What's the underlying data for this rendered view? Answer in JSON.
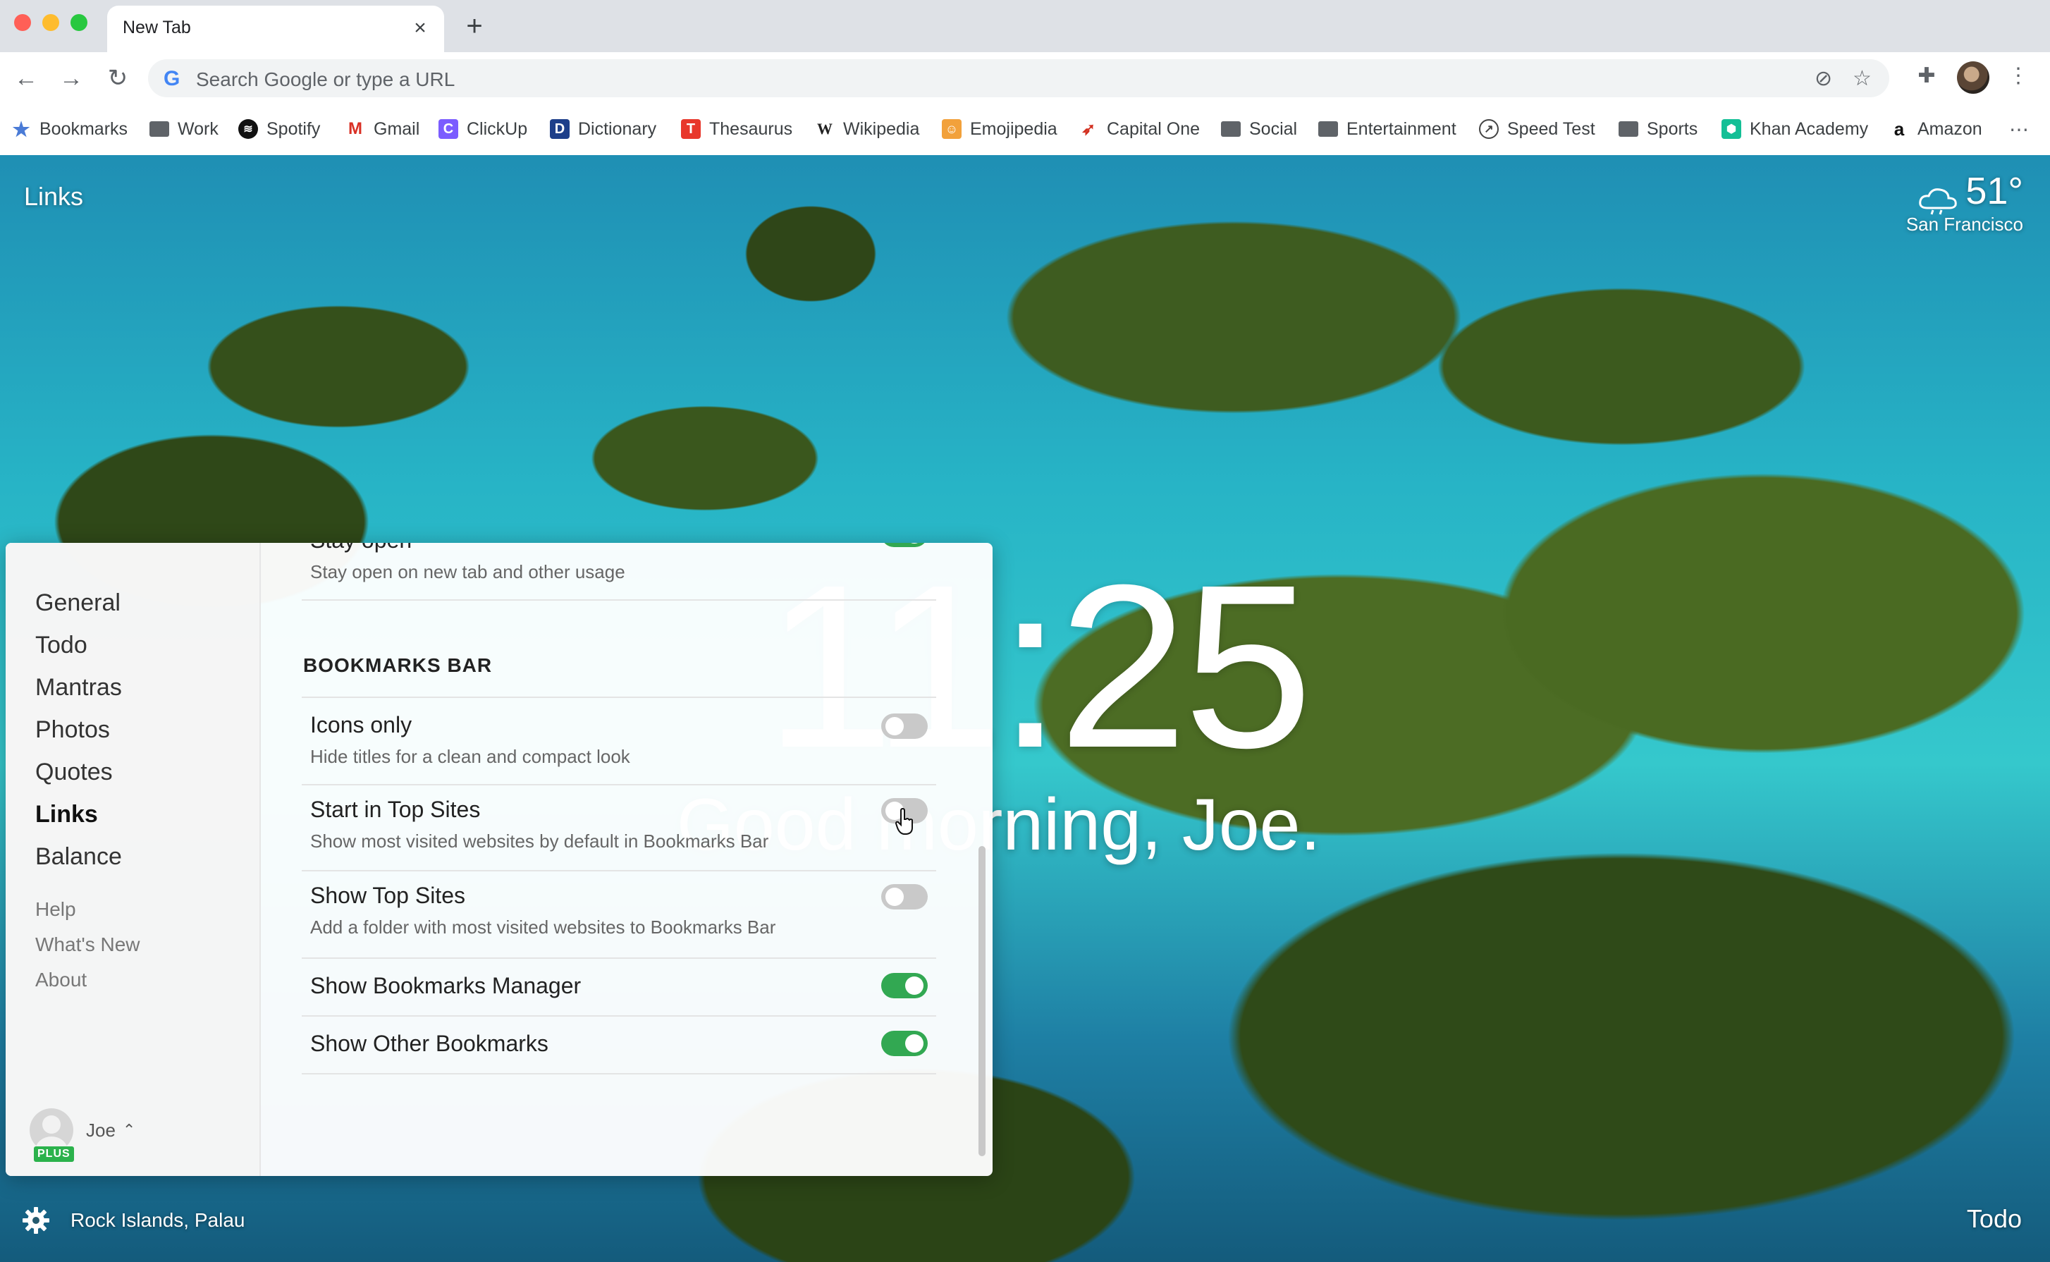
{
  "tab": {
    "title": "New Tab"
  },
  "omnibox": {
    "placeholder": "Search Google or type a URL"
  },
  "bookmarks_bar": [
    {
      "label": "Bookmarks",
      "icon": "star-icon"
    },
    {
      "label": "Work",
      "icon": "folder-icon"
    },
    {
      "label": "Spotify",
      "icon": "spotify-icon"
    },
    {
      "label": "Gmail",
      "icon": "gmail-icon"
    },
    {
      "label": "ClickUp",
      "icon": "clickup-icon"
    },
    {
      "label": "Dictionary",
      "icon": "dictionary-icon"
    },
    {
      "label": "Thesaurus",
      "icon": "thesaurus-icon"
    },
    {
      "label": "Wikipedia",
      "icon": "wikipedia-icon"
    },
    {
      "label": "Emojipedia",
      "icon": "emojipedia-icon"
    },
    {
      "label": "Capital One",
      "icon": "capital-one-icon"
    },
    {
      "label": "Social",
      "icon": "folder-icon"
    },
    {
      "label": "Entertainment",
      "icon": "folder-icon"
    },
    {
      "label": "Speed Test",
      "icon": "speedtest-icon"
    },
    {
      "label": "Sports",
      "icon": "folder-icon"
    },
    {
      "label": "Khan Academy",
      "icon": "khan-academy-icon"
    },
    {
      "label": "Amazon",
      "icon": "amazon-icon"
    }
  ],
  "dashboard": {
    "links_label": "Links",
    "weather": {
      "temp": "51°",
      "city": "San Francisco"
    },
    "clock": "11:25",
    "greeting": "Good morning, Joe.",
    "location": "Rock Islands, Palau",
    "todo_label": "Todo"
  },
  "settings": {
    "nav_main": [
      "General",
      "Todo",
      "Mantras",
      "Photos",
      "Quotes",
      "Links",
      "Balance"
    ],
    "nav_active": "Links",
    "nav_sub": [
      "Help",
      "What's New",
      "About"
    ],
    "user": {
      "name": "Joe",
      "badge": "PLUS"
    },
    "top_row": {
      "title": "Stay open",
      "desc": "Stay open on new tab and other usage",
      "on": true
    },
    "section_title": "BOOKMARKS BAR",
    "rows": [
      {
        "title": "Icons only",
        "desc": "Hide titles for a clean and compact look",
        "on": false
      },
      {
        "title": "Start in Top Sites",
        "desc": "Show most visited websites by default in Bookmarks Bar",
        "on": false
      },
      {
        "title": "Show Top Sites",
        "desc": "Add a folder with most visited websites to Bookmarks Bar",
        "on": false
      },
      {
        "title": "Show Bookmarks Manager",
        "desc": "",
        "on": true
      },
      {
        "title": "Show Other Bookmarks",
        "desc": "",
        "on": true
      }
    ]
  },
  "colors": {
    "toggle_on": "#32a852",
    "toggle_off": "#c9c9c9"
  }
}
